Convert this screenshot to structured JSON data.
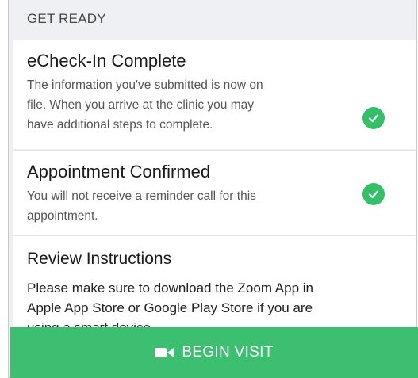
{
  "section_header": "GET READY",
  "echeckin": {
    "title": "eCheck-In Complete",
    "lines": [
      "The information you've submitted is now on",
      "file. When you arrive at the clinic you may",
      "have additional steps to complete."
    ]
  },
  "appointment": {
    "title": "Appointment Confirmed",
    "lines": [
      "You will not receive a reminder call for this",
      "appointment."
    ]
  },
  "instructions": {
    "title": "Review Instructions",
    "lines": [
      "Please make sure to download the Zoom App in",
      "Apple App Store or Google Play Store if you are",
      "using a smart device."
    ]
  },
  "begin_visit_label": "BEGIN VISIT",
  "colors": {
    "accent_green": "#3dbf72",
    "check_green": "#34c068"
  },
  "icons": {
    "status": "check-circle-icon",
    "begin": "video-camera-icon"
  }
}
